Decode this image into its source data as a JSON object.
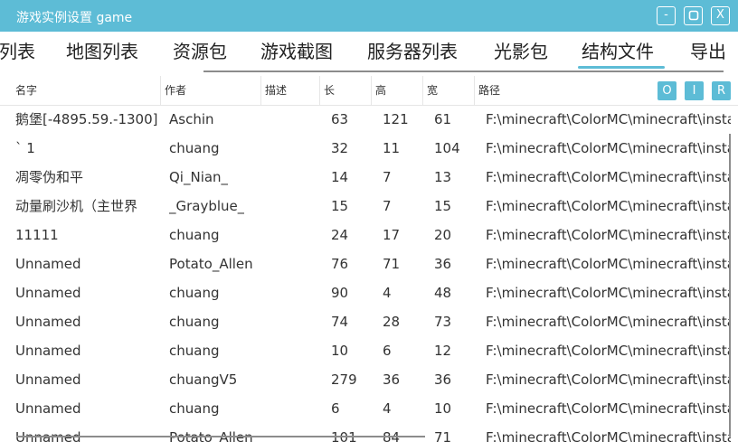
{
  "window": {
    "title": "游戏实例设置 game",
    "controls": {
      "minimize_label": "-",
      "close_label": "X"
    }
  },
  "tabs": [
    {
      "label": "列表"
    },
    {
      "label": "地图列表"
    },
    {
      "label": "资源包"
    },
    {
      "label": "游戏截图"
    },
    {
      "label": "服务器列表"
    },
    {
      "label": "光影包"
    },
    {
      "label": "结构文件",
      "selected": true
    },
    {
      "label": "导出"
    }
  ],
  "table": {
    "headers": [
      "名字",
      "作者",
      "描述",
      "长",
      "高",
      "宽",
      "路径"
    ],
    "header_buttons": [
      "O",
      "I",
      "R"
    ],
    "rows": [
      {
        "name": "鹅堡[-4895.59.-1300]",
        "author": "Aschin",
        "desc": "",
        "length": "63",
        "height": "121",
        "width": "61",
        "path": "F:\\minecraft\\ColorMC\\minecraft\\instance"
      },
      {
        "name": "` 1",
        "author": "chuang",
        "desc": "",
        "length": "32",
        "height": "11",
        "width": "104",
        "path": "F:\\minecraft\\ColorMC\\minecraft\\instance"
      },
      {
        "name": "凋零伪和平",
        "author": "Qi_Nian_",
        "desc": "",
        "length": "14",
        "height": "7",
        "width": "13",
        "path": "F:\\minecraft\\ColorMC\\minecraft\\instance"
      },
      {
        "name": "动量刷沙机（主世界",
        "author": "_Grayblue_",
        "desc": "",
        "length": "15",
        "height": "7",
        "width": "15",
        "path": "F:\\minecraft\\ColorMC\\minecraft\\instance"
      },
      {
        "name": "11111",
        "author": "chuang",
        "desc": "",
        "length": "24",
        "height": "17",
        "width": "20",
        "path": "F:\\minecraft\\ColorMC\\minecraft\\instance"
      },
      {
        "name": "Unnamed",
        "author": "Potato_Allen",
        "desc": "",
        "length": "76",
        "height": "71",
        "width": "36",
        "path": "F:\\minecraft\\ColorMC\\minecraft\\instance"
      },
      {
        "name": "Unnamed",
        "author": "chuang",
        "desc": "",
        "length": "90",
        "height": "4",
        "width": "48",
        "path": "F:\\minecraft\\ColorMC\\minecraft\\instance"
      },
      {
        "name": "Unnamed",
        "author": "chuang",
        "desc": "",
        "length": "74",
        "height": "28",
        "width": "73",
        "path": "F:\\minecraft\\ColorMC\\minecraft\\instance"
      },
      {
        "name": "Unnamed",
        "author": "chuang",
        "desc": "",
        "length": "10",
        "height": "6",
        "width": "12",
        "path": "F:\\minecraft\\ColorMC\\minecraft\\instance"
      },
      {
        "name": "Unnamed",
        "author": "chuangV5",
        "desc": "",
        "length": "279",
        "height": "36",
        "width": "36",
        "path": "F:\\minecraft\\ColorMC\\minecraft\\instance"
      },
      {
        "name": "Unnamed",
        "author": "chuang",
        "desc": "",
        "length": "6",
        "height": "4",
        "width": "10",
        "path": "F:\\minecraft\\ColorMC\\minecraft\\instance"
      },
      {
        "name": "Unnamed",
        "author": "Potato_Allen",
        "desc": "",
        "length": "101",
        "height": "84",
        "width": "71",
        "path": "F:\\minecraft\\ColorMC\\minecraft\\instance"
      }
    ]
  },
  "colors": {
    "accent": "#5dbcd6"
  }
}
